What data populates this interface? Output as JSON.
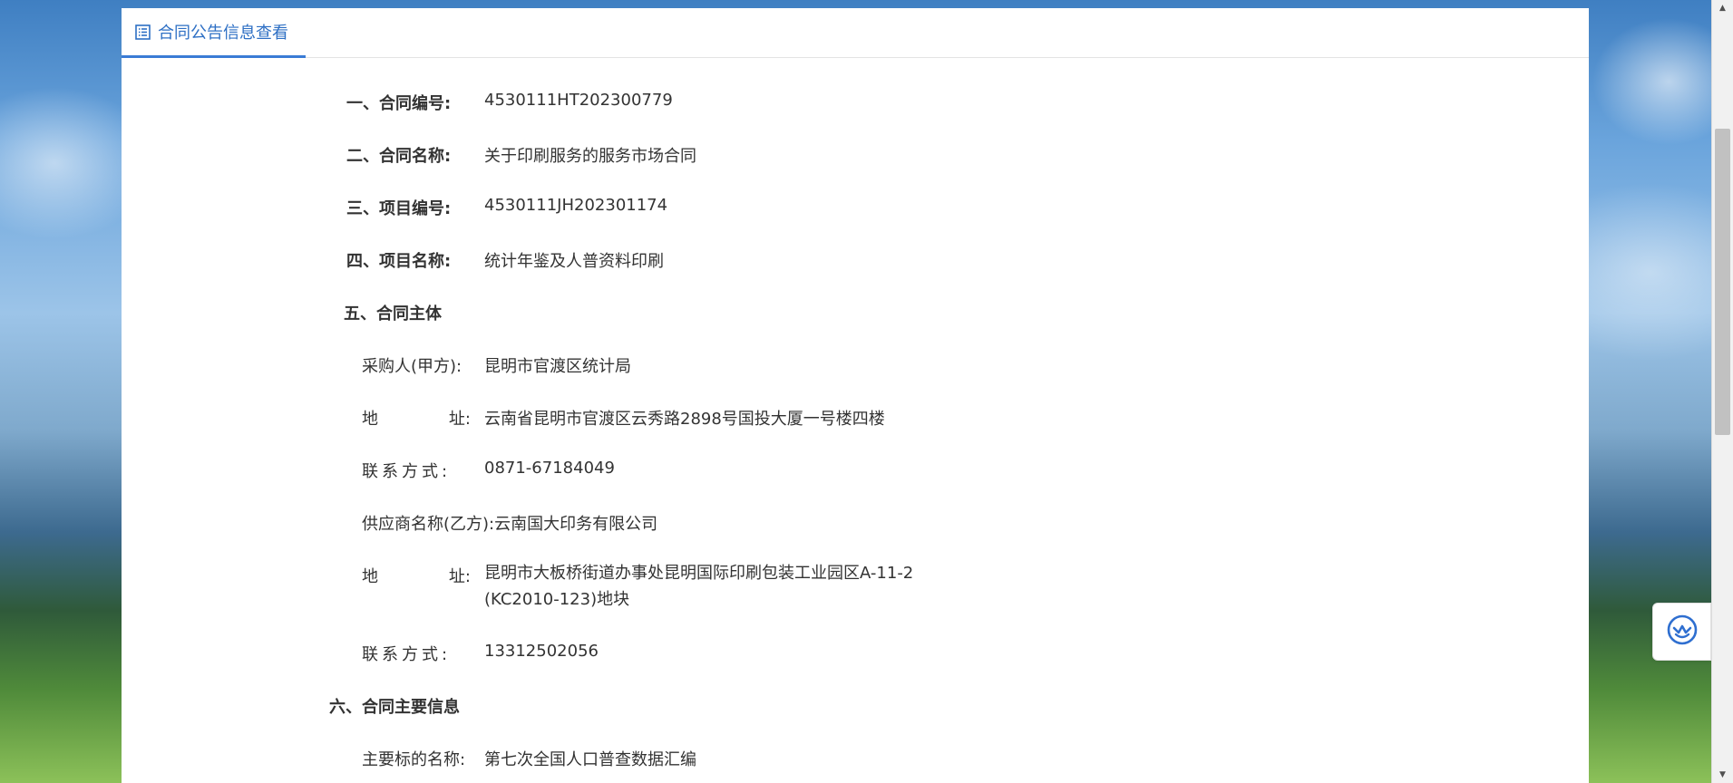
{
  "tab": {
    "label": "合同公告信息查看"
  },
  "fields": {
    "contract_no": {
      "label": "一、合同编号:",
      "value": "4530111HT202300779"
    },
    "contract_name": {
      "label": "二、合同名称:",
      "value": "关于印刷服务的服务市场合同"
    },
    "project_no": {
      "label": "三、项目编号:",
      "value": "4530111JH202301174"
    },
    "project_name": {
      "label": "四、项目名称:",
      "value": "统计年鉴及人普资料印刷"
    }
  },
  "section5": {
    "title": "五、合同主体",
    "purchaser": {
      "label": "采购人(甲方):",
      "value": "昆明市官渡区统计局"
    },
    "purchaser_address": {
      "label_a": "地",
      "label_b": "址:",
      "value": "云南省昆明市官渡区云秀路2898号国投大厦一号楼四楼"
    },
    "purchaser_contact": {
      "label": "联系方式:",
      "value": "0871-67184049"
    },
    "supplier": {
      "label": "供应商名称(乙方):",
      "value": "云南国大印务有限公司"
    },
    "supplier_address": {
      "label_a": "地",
      "label_b": "址:",
      "value_line1": "昆明市大板桥街道办事处昆明国际印刷包装工业园区A-11-2",
      "value_line2": "(KC2010-123)地块"
    },
    "supplier_contact": {
      "label": "联系方式:",
      "value": "13312502056"
    }
  },
  "section6": {
    "title": "六、合同主要信息",
    "main_subject": {
      "label": "主要标的名称:",
      "value": "第七次全国人口普查数据汇编"
    }
  },
  "icons": {
    "tab": "list-icon",
    "float": "customer-service-icon",
    "scroll_up": "arrow-up-icon",
    "scroll_down": "arrow-down-icon"
  },
  "colors": {
    "accent": "#3a7bd5",
    "text": "#333333"
  }
}
